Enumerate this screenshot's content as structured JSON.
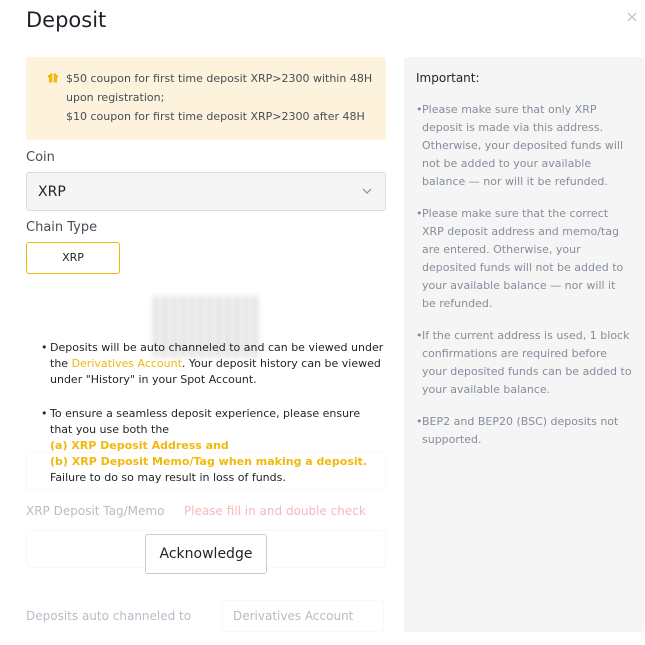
{
  "dialog": {
    "title": "Deposit",
    "close_label": "×"
  },
  "coupon": {
    "line1": "$50 coupon for first time deposit XRP>2300 within 48H",
    "line2": "upon registration;",
    "line3": "$10 coupon for first time deposit XRP>2300 after 48H"
  },
  "coin": {
    "label": "Coin",
    "value": "XRP"
  },
  "chain": {
    "label": "Chain Type",
    "value": "XRP"
  },
  "background": {
    "tag_label": "XRP Deposit Tag/Memo",
    "tag_hint": "Please fill in and double check",
    "channel_label": "Deposits auto channeled to",
    "channel_value": "Derivatives Account"
  },
  "notice": {
    "item1_before": "Deposits will be auto channeled to and can be viewed under the ",
    "item1_link": "Derivatives Account",
    "item1_after": ". Your deposit history can be viewed under \"History\" in your Spot Account.",
    "item2_intro": "To ensure a seamless deposit experience, please ensure that you use both the",
    "item2_a": "(a) XRP Deposit Address and",
    "item2_b": "(b) XRP Deposit Memo/Tag when making a deposit.",
    "item2_outro": "Failure to do so may result in loss of funds.",
    "acknowledge": "Acknowledge"
  },
  "important": {
    "title": "Important:",
    "notes": [
      "Please make sure that only XRP deposit is made via this address. Otherwise, your deposited funds will not be added to your available balance — nor will it be refunded.",
      "Please make sure that the correct XRP deposit address and memo/tag are entered. Otherwise, your deposited funds will not be added to your available balance — nor will it be refunded.",
      "If the current address is used, 1 block confirmations are required before your deposited funds can be added to your available balance.",
      "BEP2 and BEP20 (BSC) deposits not supported."
    ]
  },
  "colors": {
    "accent": "#f0b90b",
    "coupon_bg": "#fdf2dc",
    "panel_bg": "#f5f5f5"
  }
}
